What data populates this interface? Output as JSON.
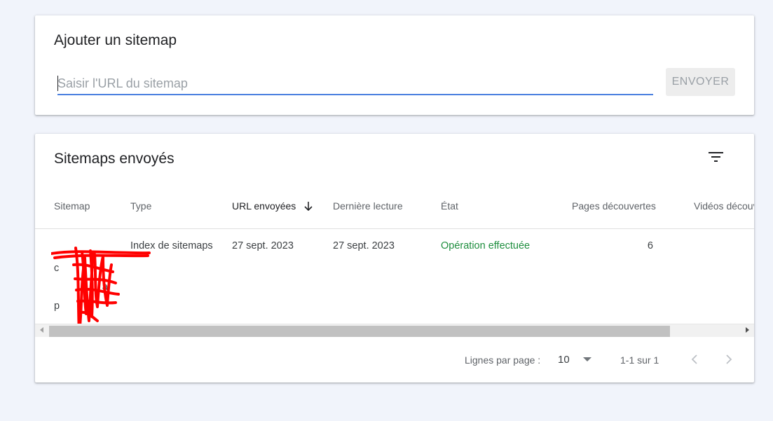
{
  "add_card": {
    "title": "Ajouter un sitemap",
    "input_placeholder": "Saisir l'URL du sitemap",
    "input_value": "",
    "send_button": "ENVOYER"
  },
  "list_card": {
    "title": "Sitemaps envoyés",
    "filter_icon": "filter-icon",
    "columns": [
      "Sitemap",
      "Type",
      "URL envoyées",
      "Dernière lecture",
      "État",
      "Pages découvertes",
      "Vidéos découv"
    ],
    "sort_column": "URL envoyées",
    "sort_icon": "arrow-down-icon",
    "rows": [
      {
        "sitemap_visible_text": [
          "c",
          "a",
          "p"
        ],
        "type": "Index de sitemaps",
        "submitted": "27 sept. 2023",
        "last_read": "27 sept. 2023",
        "status": "Opération effectuée",
        "pages_discovered": "6"
      }
    ],
    "status_color": "#1e8e3e",
    "redaction_color": "#ff0000"
  },
  "pagination": {
    "rows_per_page_label": "Lignes par page :",
    "rows_per_page_value": "10",
    "range_label": "1-1 sur 1",
    "prev_icon": "chevron-left-icon",
    "next_icon": "chevron-right-icon"
  }
}
